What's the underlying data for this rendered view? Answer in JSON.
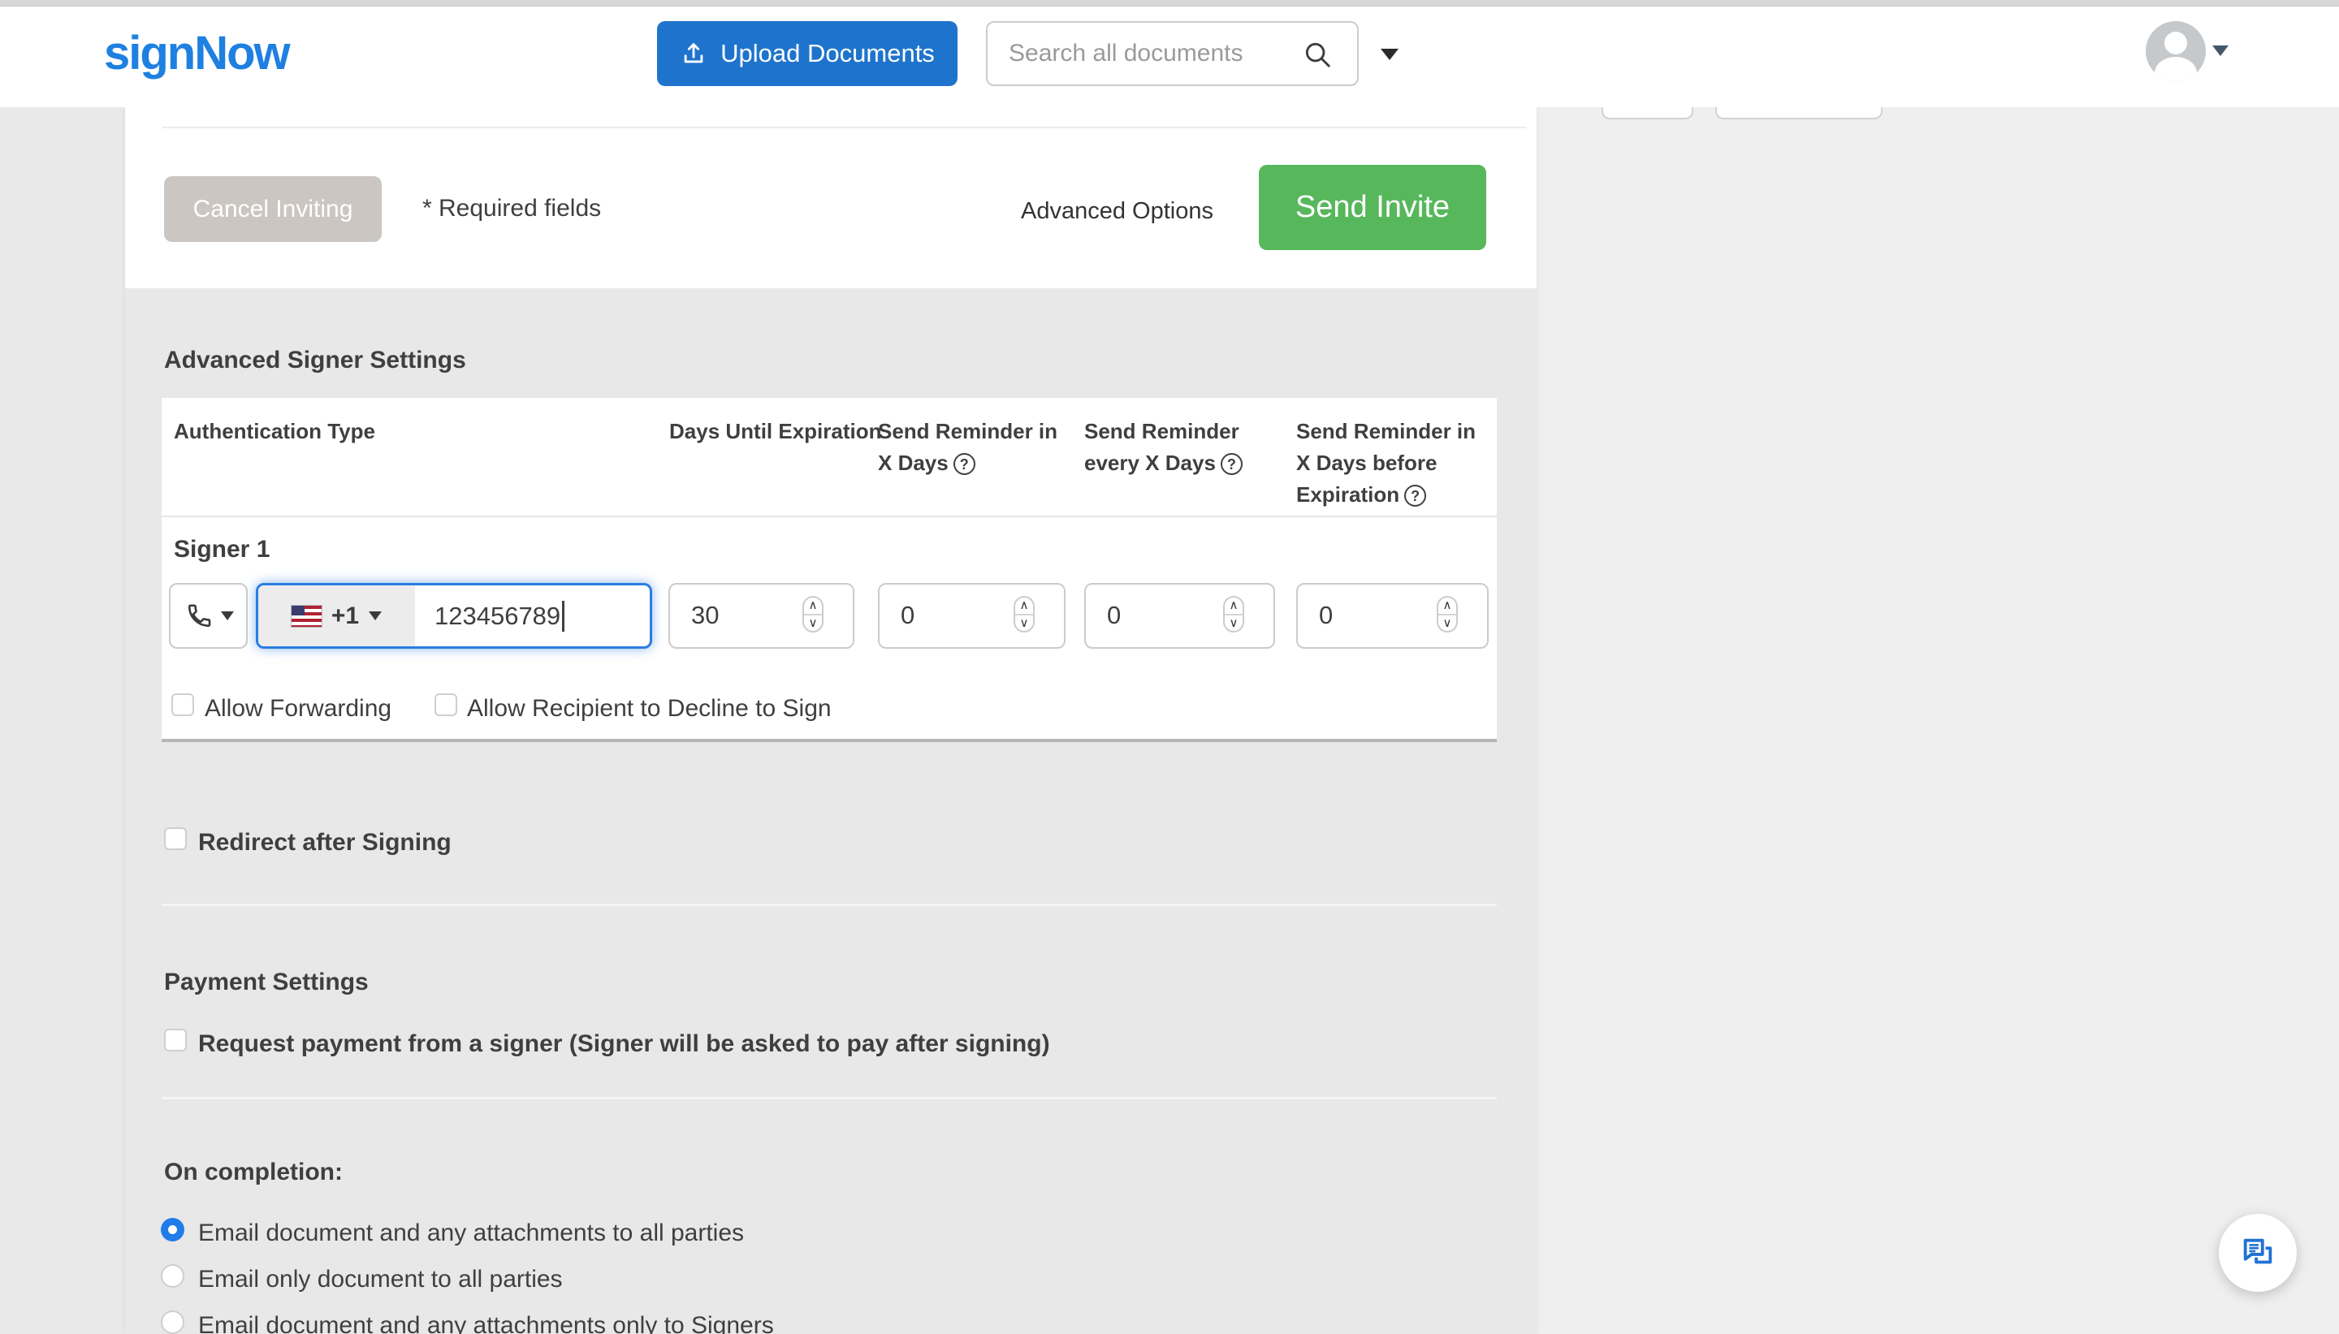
{
  "header": {
    "logo": "signNow",
    "upload_button": "Upload Documents",
    "search": {
      "placeholder": "Search all documents"
    }
  },
  "invite_bar": {
    "cancel_button": "Cancel Inviting",
    "required_note": "* Required fields",
    "advanced_options_link": "Advanced Options",
    "send_invite_button": "Send Invite"
  },
  "advanced_signer_settings": {
    "title": "Advanced Signer Settings",
    "columns": [
      {
        "label": "Authentication Type",
        "help": false
      },
      {
        "label": "Days Until Expiration",
        "help": false
      },
      {
        "label": "Send Reminder in X Days",
        "help": true
      },
      {
        "label": "Send Reminder every X Days",
        "help": true
      },
      {
        "label": "Send Reminder in X Days before Expiration",
        "help": true
      }
    ],
    "signer1": {
      "name": "Signer 1",
      "auth_type_icon": "phone",
      "country_dial_code": "+1",
      "phone_number": "123456789",
      "days_until_expiration": "30",
      "send_reminder_in_x_days": "0",
      "send_reminder_every_x_days": "0",
      "send_reminder_before_expiration": "0",
      "allow_forwarding_label": "Allow Forwarding",
      "allow_decline_label": "Allow Recipient to Decline to Sign"
    }
  },
  "sections": {
    "redirect_label": "Redirect after Signing",
    "payment_title": "Payment Settings",
    "payment_request_label": "Request payment from a signer (Signer will be asked to pay after signing)",
    "on_completion_title": "On completion:",
    "completion_options": [
      {
        "label": "Email document and any attachments to all parties",
        "selected": true
      },
      {
        "label": "Email only document to all parties",
        "selected": false
      },
      {
        "label": "Email document and any attachments only to Signers",
        "selected": false
      }
    ]
  },
  "icons": {
    "help_glyph": "?",
    "spinner_up": "∧",
    "spinner_down": "∨"
  },
  "colors": {
    "brand_blue": "#1e80e0",
    "upload_blue": "#1e74cc",
    "focus_blue": "#2a7de2",
    "radio_blue": "#1f7ce8",
    "send_green": "#57b75b",
    "cancel_gray": "#cbc6c1"
  }
}
